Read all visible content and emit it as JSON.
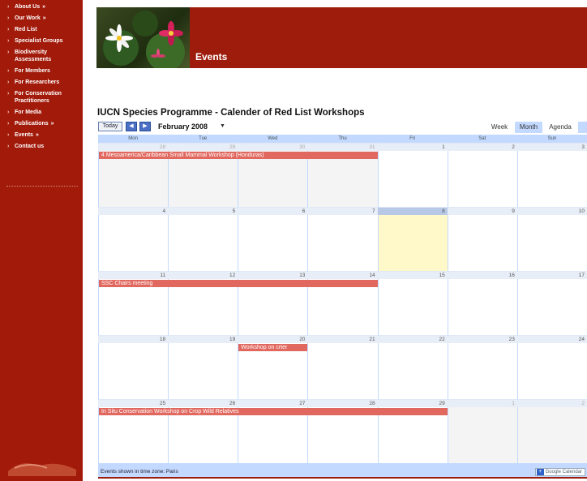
{
  "sidebar": {
    "items": [
      {
        "label": "About Us",
        "arrow": "»"
      },
      {
        "label": "Our Work",
        "arrow": "»"
      },
      {
        "label": "Red List",
        "arrow": ""
      },
      {
        "label": "Specialist Groups",
        "arrow": ""
      },
      {
        "label": "Biodiversity Assessments",
        "arrow": ""
      },
      {
        "label": "For Members",
        "arrow": ""
      },
      {
        "label": "For Researchers",
        "arrow": ""
      },
      {
        "label": "For Conservation Practitioners",
        "arrow": ""
      },
      {
        "label": "For Media",
        "arrow": ""
      },
      {
        "label": "Publications",
        "arrow": "»"
      },
      {
        "label": "Events",
        "arrow": "»"
      },
      {
        "label": "Contact us",
        "arrow": ""
      }
    ],
    "bullet": "›"
  },
  "header": {
    "title": "Events"
  },
  "calendar": {
    "title": "IUCN Species Programme - Calender of Red List Workshops",
    "today_label": "Today",
    "prev_icon": "◀",
    "next_icon": "▶",
    "month": "February 2008",
    "month_caret": "▼",
    "views": [
      "Week",
      "Month",
      "Agenda"
    ],
    "active_view": "Month",
    "day_headers": [
      "Mon",
      "Tue",
      "Wed",
      "Thu",
      "Fri",
      "Sat",
      "Sun"
    ],
    "weeks": [
      {
        "days": [
          "28",
          "29",
          "30",
          "31",
          "1",
          "2",
          "3"
        ]
      },
      {
        "days": [
          "4",
          "5",
          "6",
          "7",
          "8",
          "9",
          "10"
        ]
      },
      {
        "days": [
          "11",
          "12",
          "13",
          "14",
          "15",
          "16",
          "17"
        ]
      },
      {
        "days": [
          "18",
          "19",
          "20",
          "21",
          "22",
          "23",
          "24"
        ]
      },
      {
        "days": [
          "25",
          "26",
          "27",
          "28",
          "29",
          "1",
          "2"
        ]
      }
    ],
    "events": [
      {
        "title": "4 Mesoamerica/Caribbean Small Mammal Workshop (Honduras)"
      },
      {
        "title": "SSC Chairs meeting"
      },
      {
        "title": "Workshop on crter"
      },
      {
        "title": "In Situ Conservation Workshop on Crop Wild Relatives"
      }
    ],
    "timezone_text": "Events shown in time zone: Paris",
    "gc_plus": "+",
    "gc_label": "Google Calendar"
  },
  "colors": {
    "sidebar_bg": "#a21a0a",
    "header_bg": "#9d1c0c",
    "event_bg": "#e1685f",
    "grid_accent": "#c3d9ff",
    "today_cell": "#fff8c8"
  }
}
